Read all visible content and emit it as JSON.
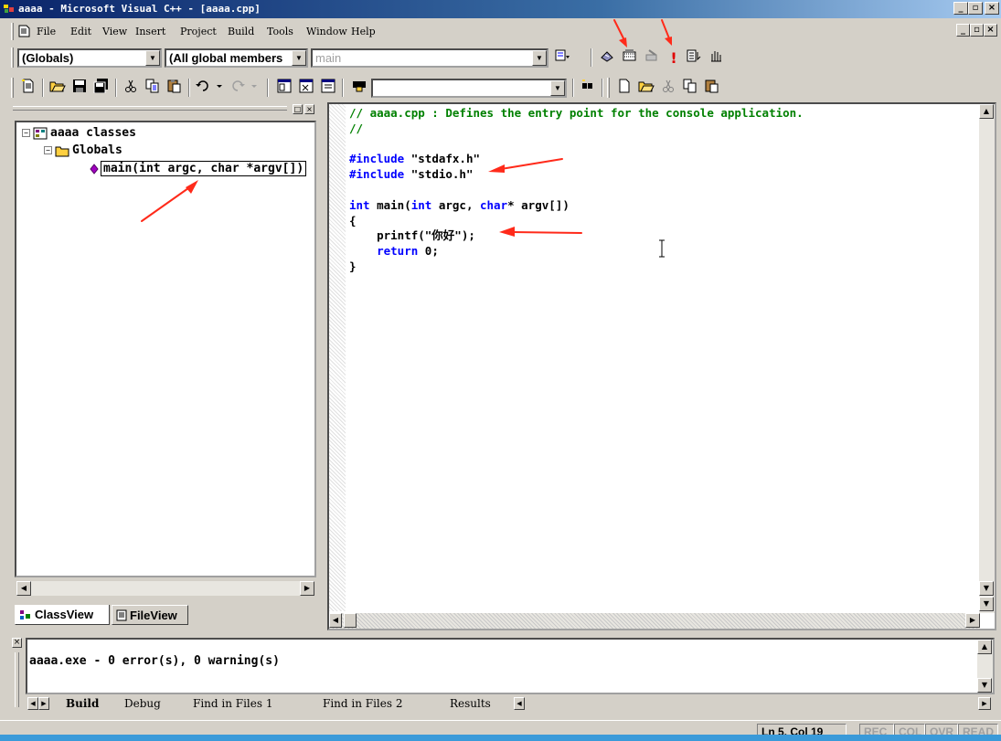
{
  "window": {
    "title": "aaaa - Microsoft Visual C++ - [aaaa.cpp]",
    "min": "_",
    "restore": "▫",
    "close": "×"
  },
  "menu": {
    "items": [
      "File",
      "Edit",
      "View",
      "Insert",
      "Project",
      "Build",
      "Tools",
      "Window",
      "Help"
    ]
  },
  "wizardbar": {
    "class_combo": "(Globals)",
    "filter_combo": "(All global members",
    "member_combo": "main"
  },
  "toolbar": {
    "find_combo": ""
  },
  "workspace": {
    "tree": {
      "root": "aaaa classes",
      "folder": "Globals",
      "function": "main(int argc, char *argv[])"
    },
    "tabs": [
      "ClassView",
      "FileView"
    ]
  },
  "editor": {
    "lines": [
      [
        {
          "t": "// aaaa.cpp : Defines the entry point for the console application.",
          "c": "comment"
        }
      ],
      [
        {
          "t": "//",
          "c": "comment"
        }
      ],
      [
        {
          "t": "",
          "c": "plain"
        }
      ],
      [
        {
          "t": "#include",
          "c": "kw"
        },
        {
          "t": " \"stdafx.h\"",
          "c": "plain"
        }
      ],
      [
        {
          "t": "#include",
          "c": "kw"
        },
        {
          "t": " \"stdio.h\"",
          "c": "plain"
        }
      ],
      [
        {
          "t": "",
          "c": "plain"
        }
      ],
      [
        {
          "t": "int",
          "c": "kw"
        },
        {
          "t": " main(",
          "c": "plain"
        },
        {
          "t": "int",
          "c": "kw"
        },
        {
          "t": " argc, ",
          "c": "plain"
        },
        {
          "t": "char",
          "c": "kw"
        },
        {
          "t": "* argv[])",
          "c": "plain"
        }
      ],
      [
        {
          "t": "{",
          "c": "plain"
        }
      ],
      [
        {
          "t": "    printf(\"你好\");",
          "c": "plain"
        }
      ],
      [
        {
          "t": "    ",
          "c": "plain"
        },
        {
          "t": "return",
          "c": "kw"
        },
        {
          "t": " 0;",
          "c": "plain"
        }
      ],
      [
        {
          "t": "}",
          "c": "plain"
        }
      ]
    ]
  },
  "output": {
    "text": "aaaa.exe - 0 error(s), 0 warning(s)",
    "tabs": [
      "Build",
      "Debug",
      "Find in Files 1",
      "Find in Files 2",
      "Results"
    ]
  },
  "status": {
    "position": "Ln 5, Col 19",
    "rec": "REC",
    "col": "COL",
    "ovr": "OVR",
    "read": "READ"
  },
  "colors": {
    "comment": "#008000",
    "keyword": "#0000ff",
    "annotation_arrow": "#ff2a1a"
  }
}
